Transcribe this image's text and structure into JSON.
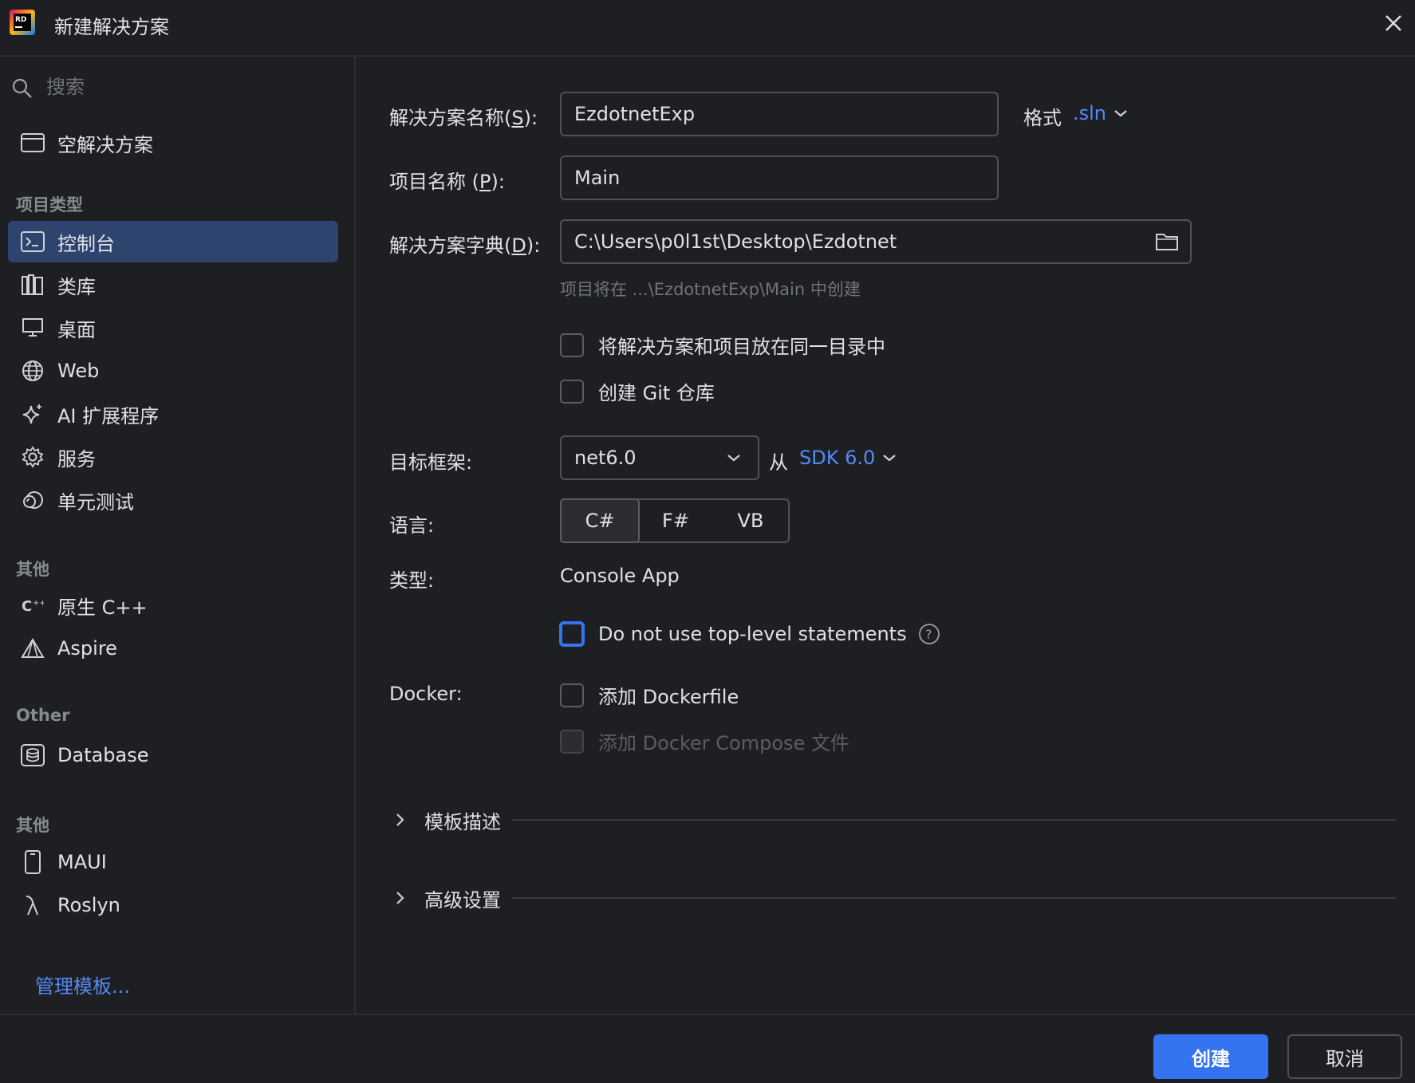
{
  "window": {
    "title": "新建解决方案"
  },
  "sidebar": {
    "search_placeholder": "搜索",
    "empty_solution": "空解决方案",
    "groups": [
      {
        "label": "项目类型",
        "items": [
          "控制台",
          "类库",
          "桌面",
          "Web",
          "AI 扩展程序",
          "服务",
          "单元测试"
        ]
      },
      {
        "label": "其他",
        "items": [
          "原生 C++",
          "Aspire"
        ]
      },
      {
        "label": "Other",
        "items": [
          "Database"
        ]
      },
      {
        "label": "其他",
        "items": [
          "MAUI",
          "Roslyn"
        ]
      }
    ],
    "selected": "控制台",
    "manage_templates": "管理模板..."
  },
  "form": {
    "solution_name": {
      "label_pre": "解决方案名称(",
      "mnemonic": "S",
      "label_post": "):",
      "value": "EzdotnetExp"
    },
    "format": {
      "label": "格式",
      "value": ".sln"
    },
    "project_name": {
      "label_pre": "项目名称 (",
      "mnemonic": "P",
      "label_post": "):",
      "value": "Main"
    },
    "solution_dir": {
      "label_pre": "解决方案字典(",
      "mnemonic": "D",
      "label_post": "):",
      "value": "C:\\Users\\p0l1st\\Desktop\\Ezdotnet"
    },
    "hint": "项目将在 ...\\EzdotnetExp\\Main 中创建",
    "same_dir_checkbox": "将解决方案和项目放在同一目录中",
    "git_checkbox": "创建 Git 仓库",
    "target_framework": {
      "label": "目标框架:",
      "value": "net6.0",
      "from": "从",
      "sdk": "SDK 6.0"
    },
    "language": {
      "label": "语言:",
      "options": [
        "C#",
        "F#",
        "VB"
      ],
      "selected": "C#"
    },
    "type": {
      "label": "类型:",
      "value": "Console App"
    },
    "top_level_checkbox": "Do not use top-level statements",
    "docker": {
      "label": "Docker:",
      "dockerfile": "添加 Dockerfile",
      "compose": "添加 Docker Compose 文件"
    },
    "sections": [
      "模板描述",
      "高级设置"
    ]
  },
  "footer": {
    "create": "创建",
    "cancel": "取消"
  },
  "colors": {
    "accent": "#3574f0",
    "link": "#548af7",
    "selected_bg": "#2e436e",
    "background": "#1e1f22"
  }
}
